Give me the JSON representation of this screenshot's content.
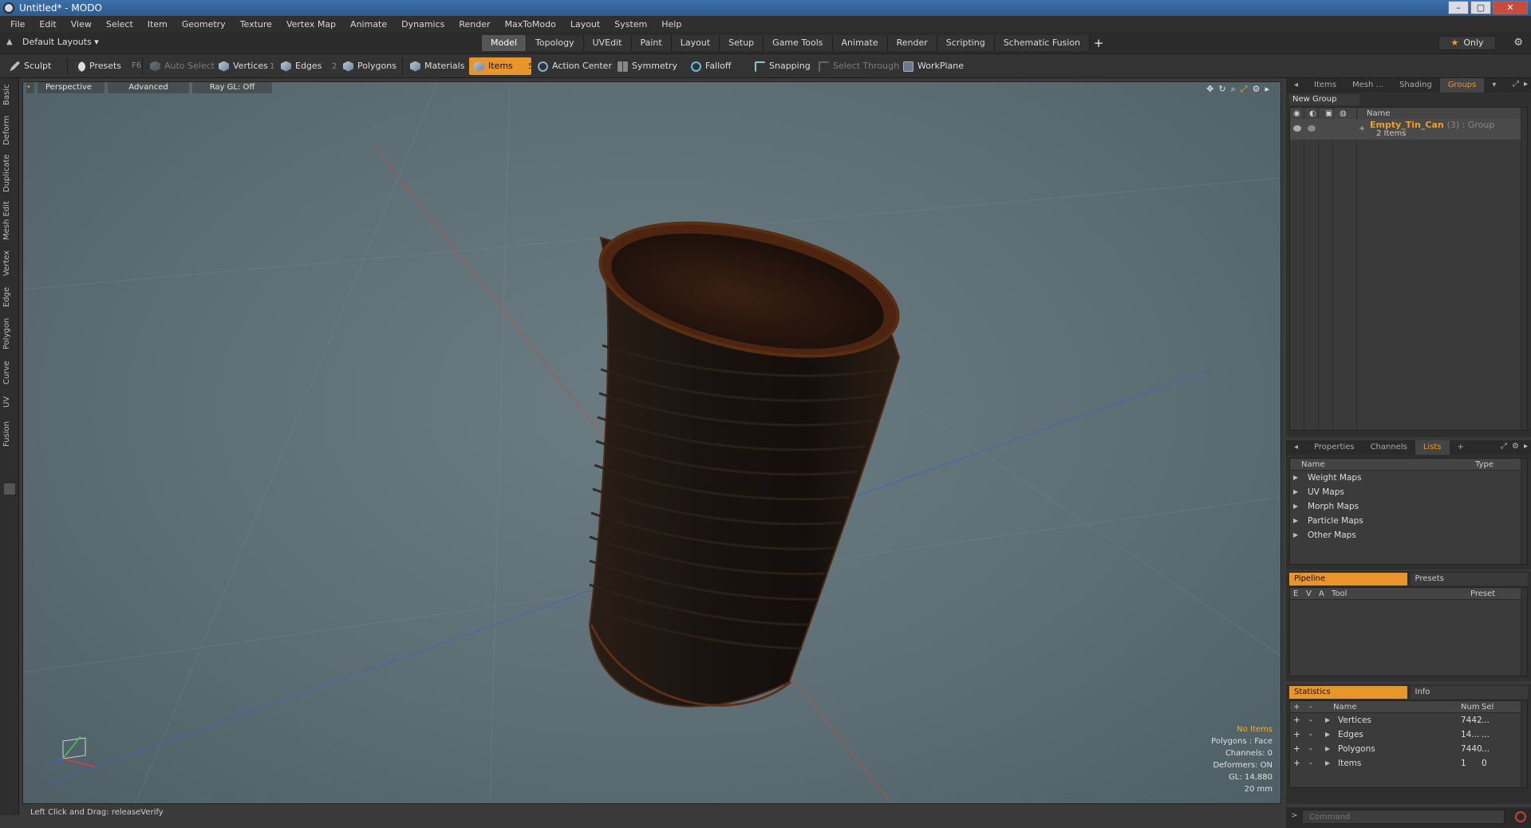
{
  "window": {
    "title": "Untitled* - MODO",
    "min": "–",
    "max": "▢",
    "close": "✕"
  },
  "menu": [
    "File",
    "Edit",
    "View",
    "Select",
    "Item",
    "Geometry",
    "Texture",
    "Vertex Map",
    "Animate",
    "Dynamics",
    "Render",
    "MaxToModo",
    "Layout",
    "System",
    "Help"
  ],
  "layouts": {
    "label": "Default Layouts ▾"
  },
  "workspace_tabs": [
    "Model",
    "Topology",
    "UVEdit",
    "Paint",
    "Layout",
    "Setup",
    "Game Tools",
    "Animate",
    "Render",
    "Scripting",
    "Schematic Fusion"
  ],
  "workspace_active": "Model",
  "only_label": "Only",
  "toolbar": {
    "sculpt": "Sculpt",
    "presets": "Presets",
    "presets_key": "F6",
    "auto_select": "Auto Select",
    "vertices": "Vertices",
    "vertices_key": "1",
    "edges": "Edges",
    "edges_key": "2",
    "polygons": "Polygons",
    "materials": "Materials",
    "items": "Items",
    "items_key": "5",
    "action_center": "Action Center",
    "symmetry": "Symmetry",
    "falloff": "Falloff",
    "snapping": "Snapping",
    "select_through": "Select Through",
    "workplane": "WorkPlane"
  },
  "left_tabs": [
    "Basic",
    "Deform",
    "Duplicate",
    "Mesh Edit",
    "Vertex",
    "Edge",
    "Polygon",
    "Curve",
    "UV",
    "Fusion"
  ],
  "viewport": {
    "view_mode": "Perspective",
    "advanced": "Advanced",
    "raygl": "Ray GL: Off",
    "stats": {
      "no_items": "No Items",
      "polygons": "Polygons : Face",
      "channels": "Channels: 0",
      "deformers": "Deformers: ON",
      "gl": "GL: 14,880",
      "scale": "20 mm"
    }
  },
  "status_text": "Left Click and Drag:  releaseVerify",
  "groups_panel": {
    "tabs": [
      "Items",
      "Mesh ...",
      "Shading",
      "Groups"
    ],
    "active": "Groups",
    "new_group": "New Group",
    "name_header": "Name",
    "group_name": "Empty_Tin_Can",
    "group_meta": "(3) : Group",
    "group_count": "2 Items"
  },
  "lists_panel": {
    "tabs": [
      "Properties",
      "Channels",
      "Lists"
    ],
    "active": "Lists",
    "col_name": "Name",
    "col_type": "Type",
    "rows": [
      "Weight Maps",
      "UV Maps",
      "Morph Maps",
      "Particle Maps",
      "Other Maps"
    ]
  },
  "pipeline_panel": {
    "toggle_on": "Pipeline",
    "toggle_off": "Presets",
    "cols": [
      "E",
      "V",
      "A",
      "Tool",
      "Preset"
    ]
  },
  "stats_panel": {
    "toggle_on": "Statistics",
    "toggle_off": "Info",
    "cols": {
      "add": "+",
      "sub": "-",
      "name": "Name",
      "num": "Num",
      "sel": "Sel"
    },
    "rows": [
      {
        "name": "Vertices",
        "num": "7442",
        "sel": "..."
      },
      {
        "name": "Edges",
        "num": "14...",
        "sel": "..."
      },
      {
        "name": "Polygons",
        "num": "7440",
        "sel": "..."
      },
      {
        "name": "Items",
        "num": "1",
        "sel": "0"
      }
    ]
  },
  "command": {
    "placeholder": "Command",
    "arrow": ">"
  },
  "colors": {
    "accent": "#e8952a",
    "viewport_bg": "#5d6e75",
    "can": "#1a1512",
    "can_rim": "#5a2e12"
  }
}
